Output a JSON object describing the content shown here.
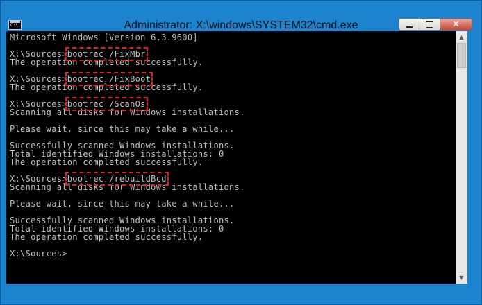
{
  "window": {
    "title": "Administrator: X:\\windows\\SYSTEM32\\cmd.exe",
    "app_icon": "cmd-icon",
    "app_icon_text": "C:\\",
    "controls": {
      "minimize_icon": "minimize-icon",
      "maximize_icon": "maximize-icon",
      "close_label": "✕"
    }
  },
  "console": {
    "lines": [
      "Microsoft Windows [Version 6.3.9600]",
      "",
      "X:\\Sources>bootrec /FixMbr",
      "The operation completed successfully.",
      "",
      "X:\\Sources>bootrec /FixBoot",
      "The operation completed successfully.",
      "",
      "X:\\Sources>bootrec /ScanOs",
      "Scanning all disks for Windows installations.",
      "",
      "Please wait, since this may take a while...",
      "",
      "Successfully scanned Windows installations.",
      "Total identified Windows installations: 0",
      "The operation completed successfully.",
      "",
      "X:\\Sources>bootrec /rebuildBcd",
      "Scanning all disks for Windows installations.",
      "",
      "Please wait, since this may take a while...",
      "",
      "Successfully scanned Windows installations.",
      "Total identified Windows installations: 0",
      "The operation completed successfully.",
      "",
      "X:\\Sources>"
    ],
    "prompt": "X:\\Sources>",
    "highlighted_commands": [
      "bootrec /FixMbr",
      "bootrec /FixBoot",
      "bootrec /ScanOs",
      "bootrec /rebuildBcd"
    ],
    "highlight_color": "#e0201c",
    "background": "#000000",
    "foreground": "#c0c0c0"
  },
  "scrollbar": {
    "up_icon": "scroll-up-arrow-icon",
    "down_icon": "scroll-down-arrow-icon",
    "position": 0.0
  }
}
